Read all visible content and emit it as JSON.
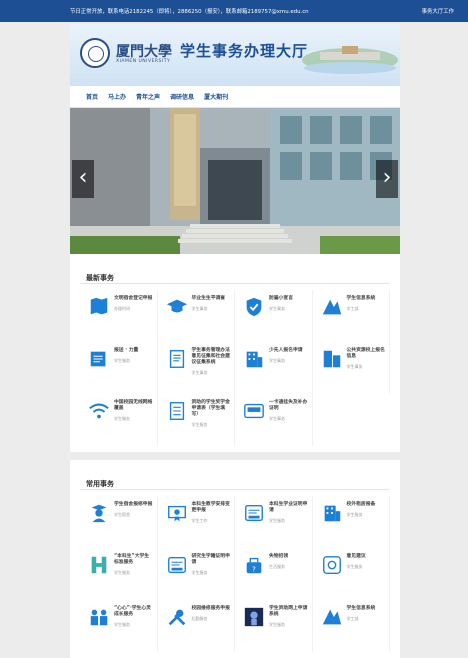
{
  "topbar": {
    "notice": "节日正常开放，联系电话2182245（即将），2886250（报安），联系邮箱2189757@xmu.edu.cn",
    "right": "事务大厅工作"
  },
  "header": {
    "univ_cn": "厦門大學",
    "univ_en": "XIAMEN UNIVERSITY",
    "hall_title": "学生事务办理大厅"
  },
  "nav": [
    "首页",
    "马上办",
    "青年之声",
    "调研信息",
    "厦大期刊"
  ],
  "slider": {
    "prev": "‹",
    "next": "›"
  },
  "latest": {
    "title": "最新事务",
    "items": [
      {
        "name": "文明宿舍登记申报",
        "sub": "办理时间",
        "icon": "map-icon",
        "color": "#1e7fd6"
      },
      {
        "name": "毕业生生平调查",
        "sub": "学生事务",
        "icon": "graduation-cap-icon",
        "color": "#1e7fd6"
      },
      {
        "name": "防骗小宣言",
        "sub": "学生事务",
        "icon": "shield-check-icon",
        "color": "#1e7fd6"
      },
      {
        "name": "学生信息系统",
        "sub": "学工部",
        "icon": "xmu-logo-icon",
        "color": "#1e7fd6"
      },
      {
        "name": "报送 · 力量",
        "sub": "学生服务",
        "icon": "pen-book-icon",
        "color": "#1e7fd6"
      },
      {
        "name": "学生事务管理办法意见征集和社会建议征集系统",
        "sub": "学生事务",
        "icon": "document-icon",
        "color": "#1e7fd6"
      },
      {
        "name": "少先人报名申请",
        "sub": "学生事务",
        "icon": "building-icon",
        "color": "#1e7fd6"
      },
      {
        "name": "公共资源校上报名信息",
        "sub": "学生事务",
        "icon": "office-icon",
        "color": "#1e7fd6"
      },
      {
        "name": "中国校园无线网络覆盖",
        "sub": "学生服务",
        "icon": "wifi-icon",
        "color": "#1e7fd6"
      },
      {
        "name": "资助的学生奖学金申请表（学生填写）",
        "sub": "学生服务",
        "icon": "form-icon",
        "color": "#1e7fd6"
      },
      {
        "name": "一卡通挂失及补办证明",
        "sub": "学生事务",
        "icon": "card-icon",
        "color": "#1e7fd6"
      }
    ]
  },
  "common": {
    "title": "常用事务",
    "items": [
      {
        "name": "学生宿舍报修申报",
        "sub": "学生宿舍",
        "icon": "graduate-person-icon"
      },
      {
        "name": "本科生教学安排变更申报",
        "sub": "学生工作",
        "icon": "certificate-icon"
      },
      {
        "name": "本科生学业证明申请",
        "sub": "学生服务",
        "icon": "student-card-icon"
      },
      {
        "name": "校外租房报备",
        "sub": "学生服务",
        "icon": "building-icon"
      },
      {
        "name": "“本科生”大学生标准服务",
        "sub": "学生服务",
        "icon": "xmu-h-icon"
      },
      {
        "name": "研究生学籍证明申请",
        "sub": "学生服务",
        "icon": "student-card-icon"
      },
      {
        "name": "失物招领",
        "sub": "生活服务",
        "icon": "lost-found-icon"
      },
      {
        "name": "意见建议",
        "sub": "学生服务",
        "icon": "feedback-icon"
      },
      {
        "name": "“心心”·学生心灵成长服务",
        "sub": "学生服务",
        "icon": "students-icon"
      },
      {
        "name": "校园维修服务申报",
        "sub": "后勤服务",
        "icon": "tools-icon"
      },
      {
        "name": "学生资助网上申请系统",
        "sub": "学生服务",
        "icon": "poster-icon"
      },
      {
        "name": "学生信息系统",
        "sub": "学工部",
        "icon": "xmu-logo-icon"
      }
    ]
  }
}
